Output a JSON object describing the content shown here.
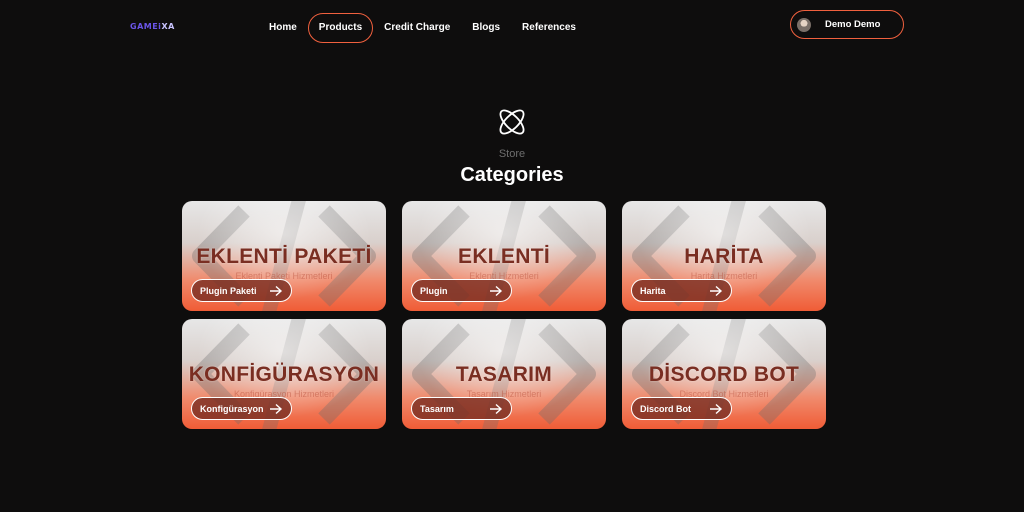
{
  "logo": {
    "text_main": "GAMEi",
    "text_accent": "XA"
  },
  "nav": {
    "items": [
      {
        "label": "Home",
        "active": false
      },
      {
        "label": "Products",
        "active": true
      },
      {
        "label": "Credit Charge",
        "active": false
      },
      {
        "label": "Blogs",
        "active": false
      },
      {
        "label": "References",
        "active": false
      }
    ],
    "user": {
      "name": "Demo Demo"
    }
  },
  "section": {
    "icon": "atom-icon",
    "subtitle": "Store",
    "title": "Categories"
  },
  "categories": [
    {
      "title": "EKLENTİ PAKETİ",
      "description": "Eklenti Paketi Hizmetleri",
      "button": "Plugin Paketi"
    },
    {
      "title": "EKLENTİ",
      "description": "Eklenti Hizmetleri",
      "button": "Plugin"
    },
    {
      "title": "HARİTA",
      "description": "Harita Hizmetleri",
      "button": "Harita"
    },
    {
      "title": "KONFİGÜRASYON",
      "description": "Konfigürasyon Hizmetleri",
      "button": "Konfigürasyon"
    },
    {
      "title": "TASARIM",
      "description": "Tasarım Hizmetleri",
      "button": "Tasarım"
    },
    {
      "title": "DİSCORD BOT",
      "description": "Discord Bot Hizmetleri",
      "button": "Discord Bot"
    }
  ],
  "colors": {
    "accent": "#f0603e",
    "background": "#0e0d0d",
    "card_title": "#7a2e22",
    "logo": "#6a55e8"
  }
}
